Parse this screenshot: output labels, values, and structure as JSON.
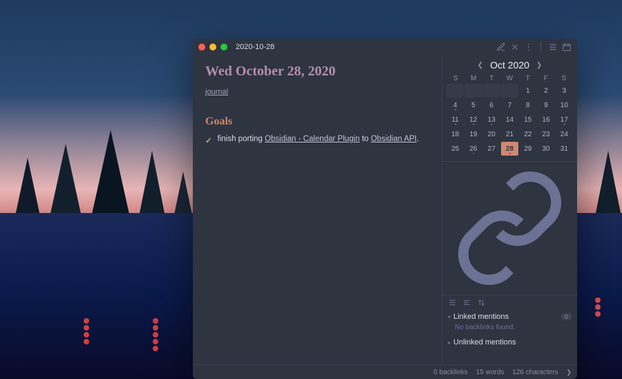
{
  "window": {
    "title": "2020-10-28"
  },
  "note": {
    "heading": "Wed October 28, 2020",
    "tag": "journal",
    "goals_heading": "Goals",
    "task_pre": "finish porting ",
    "task_link1": "Obsidian - Calendar Plugin",
    "task_mid": " to ",
    "task_link2": "Obsidian API",
    "task_post": "."
  },
  "calendar": {
    "month_label": "Oct 2020",
    "dow": [
      "S",
      "M",
      "T",
      "W",
      "T",
      "F",
      "S"
    ],
    "leading_blanks": 4,
    "days": [
      {
        "n": 1,
        "dots": 0
      },
      {
        "n": 2,
        "dots": 0
      },
      {
        "n": 3,
        "dots": 0
      },
      {
        "n": 4,
        "dots": 2
      },
      {
        "n": 5,
        "dots": 0
      },
      {
        "n": 6,
        "dots": 0
      },
      {
        "n": 7,
        "dots": 0
      },
      {
        "n": 8,
        "dots": 0
      },
      {
        "n": 9,
        "dots": 0
      },
      {
        "n": 10,
        "dots": 0
      },
      {
        "n": 11,
        "dots": 2
      },
      {
        "n": 12,
        "dots": 2
      },
      {
        "n": 13,
        "dots": 2
      },
      {
        "n": 14,
        "dots": 0
      },
      {
        "n": 15,
        "dots": 0
      },
      {
        "n": 16,
        "dots": 0
      },
      {
        "n": 17,
        "dots": 2
      },
      {
        "n": 18,
        "dots": 0
      },
      {
        "n": 19,
        "dots": 0
      },
      {
        "n": 20,
        "dots": 0
      },
      {
        "n": 21,
        "dots": 0
      },
      {
        "n": 22,
        "dots": 0
      },
      {
        "n": 23,
        "dots": 0
      },
      {
        "n": 24,
        "dots": 0
      },
      {
        "n": 25,
        "dots": 0
      },
      {
        "n": 26,
        "dots": 1
      },
      {
        "n": 27,
        "dots": 0
      },
      {
        "n": 28,
        "dots": 1,
        "today": true
      },
      {
        "n": 29,
        "dots": 0
      },
      {
        "n": 30,
        "dots": 0
      },
      {
        "n": 31,
        "dots": 0
      }
    ]
  },
  "backlinks": {
    "linked_label": "Linked mentions",
    "linked_count": "0",
    "linked_empty": "No backlinks found.",
    "unlinked_label": "Unlinked mentions"
  },
  "status": {
    "backlinks": "0 backlinks",
    "words": "15 words",
    "chars": "126 characters"
  }
}
